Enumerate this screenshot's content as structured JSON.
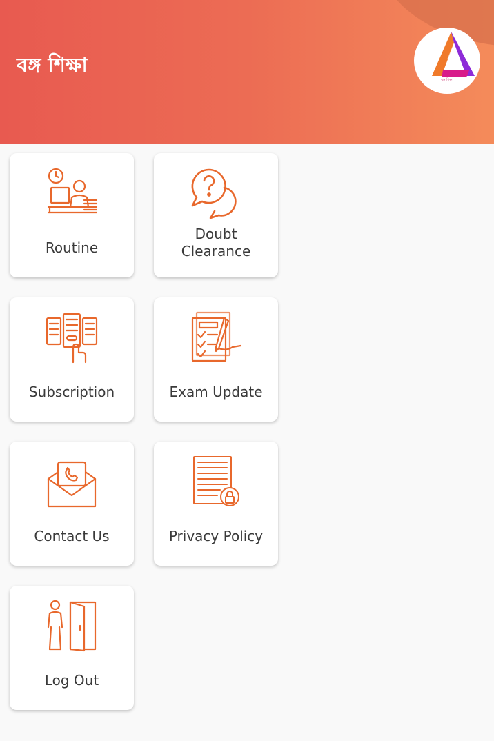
{
  "header": {
    "title": "বঙ্গ শিক্ষা",
    "logo_caption": "বঙ্গ শিক্ষা"
  },
  "menu": {
    "routine": "Routine",
    "doubt_clearance": "Doubt\nClearance",
    "subscription": "Subscription",
    "exam_update": "Exam Update",
    "contact_us": "Contact Us",
    "privacy_policy": "Privacy Policy",
    "log_out": "Log Out"
  },
  "colors": {
    "header_start": "#e85a50",
    "header_end": "#f48b5a",
    "icon_accent": "#e8682c",
    "background": "#f9f9f9"
  }
}
